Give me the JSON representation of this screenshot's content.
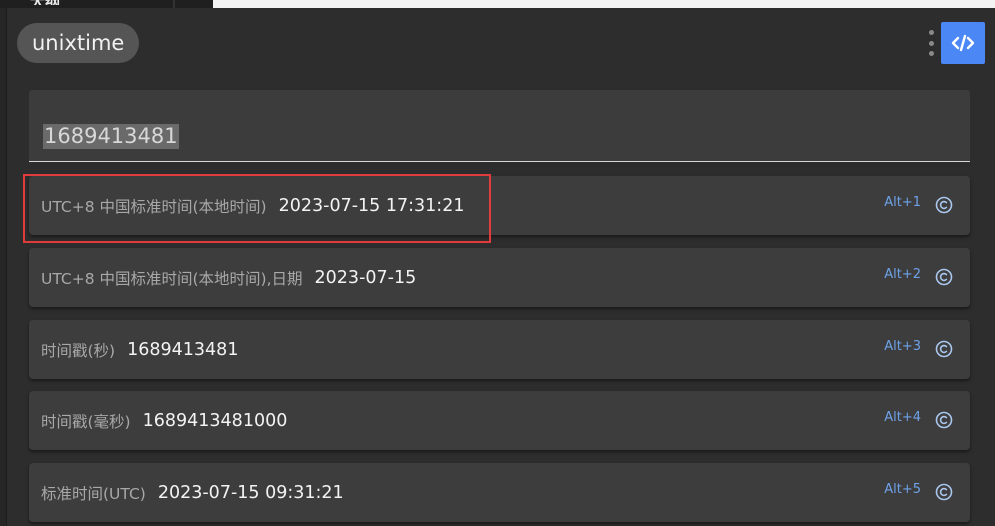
{
  "background": {
    "partial_label": "大纲"
  },
  "header": {
    "plugin_name": "unixtime",
    "more_icon": "more-vertical-icon",
    "code_icon": "code-icon",
    "accent_color": "#4b88f5"
  },
  "search": {
    "value": "1689413481"
  },
  "results": [
    {
      "description": "UTC+8 中国标准时间(本地时间)",
      "value": "2023-07-15 17:31:21",
      "shortcut": "Alt+1",
      "highlighted": true
    },
    {
      "description": "UTC+8 中国标准时间(本地时间),日期",
      "value": "2023-07-15",
      "shortcut": "Alt+2"
    },
    {
      "description": "时间戳(秒)",
      "value": "1689413481",
      "shortcut": "Alt+3"
    },
    {
      "description": "时间戳(毫秒)",
      "value": "1689413481000",
      "shortcut": "Alt+4"
    },
    {
      "description": "标准时间(UTC)",
      "value": "2023-07-15 09:31:21",
      "shortcut": "Alt+5"
    }
  ],
  "colors": {
    "highlight_border": "#e23b3b",
    "shortcut_text": "#6ea2e8"
  }
}
